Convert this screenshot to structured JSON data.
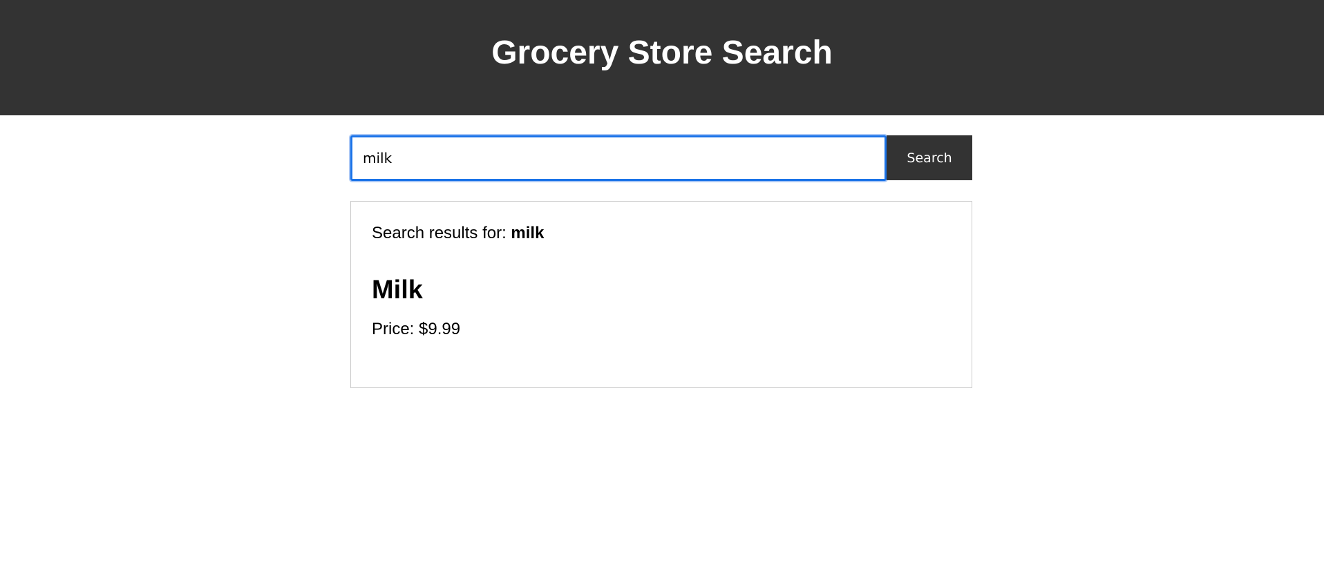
{
  "header": {
    "title": "Grocery Store Search"
  },
  "search": {
    "value": "milk",
    "button_label": "Search"
  },
  "results": {
    "prefix": "Search results for: ",
    "query": "milk",
    "items": [
      {
        "name": "Milk",
        "price_text": "Price: $9.99"
      }
    ]
  },
  "colors": {
    "header_bg": "#333333",
    "focus_border": "#1a73e8",
    "button_bg": "#333333"
  }
}
